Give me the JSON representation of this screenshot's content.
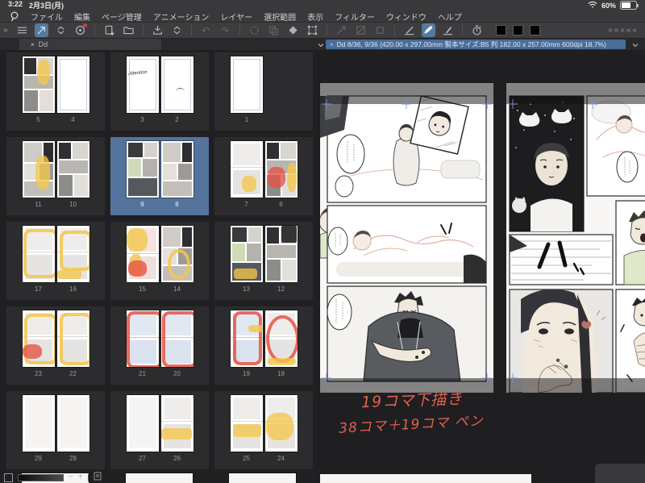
{
  "status_bar": {
    "time": "3:22",
    "date": "2月3日(月)",
    "battery_percent": "60%"
  },
  "menu_bar": {
    "items": [
      "ファイル",
      "編集",
      "ページ管理",
      "アニメーション",
      "レイヤー",
      "選択範囲",
      "表示",
      "フィルター",
      "ウィンドウ",
      "ヘルプ"
    ]
  },
  "toolbar": {
    "collapse_left": "»",
    "collapse_right": "«««««",
    "icons": [
      {
        "name": "main-menu"
      },
      {
        "name": "tool-cursor",
        "active": true
      },
      {
        "name": "chevron-updown"
      },
      {
        "name": "asset-library",
        "badge": true
      },
      {
        "name": "separator"
      },
      {
        "name": "new-page"
      },
      {
        "name": "open-folder"
      },
      {
        "name": "separator"
      },
      {
        "name": "export-tray"
      },
      {
        "name": "chevron-updown"
      },
      {
        "name": "separator"
      },
      {
        "name": "undo",
        "disabled": true
      },
      {
        "name": "redo",
        "disabled": true
      },
      {
        "name": "separator"
      },
      {
        "name": "spinner",
        "disabled": true
      },
      {
        "name": "paste",
        "disabled": true
      },
      {
        "name": "eraser"
      },
      {
        "name": "transform-frame"
      },
      {
        "name": "separator"
      },
      {
        "name": "select-line",
        "disabled": true
      },
      {
        "name": "select-fill",
        "disabled": true
      },
      {
        "name": "stamp",
        "disabled": true
      },
      {
        "name": "separator"
      },
      {
        "name": "ruler-pen"
      },
      {
        "name": "brush",
        "active": true
      },
      {
        "name": "pen-line"
      },
      {
        "name": "separator"
      },
      {
        "name": "auto-action-timer"
      }
    ],
    "swatches": [
      "#000000",
      "#000000",
      "#000000"
    ]
  },
  "tab_bar": {
    "panel_tab": {
      "close": "×",
      "label": "Dd"
    },
    "document_tab": {
      "close": "×",
      "title": "Dd 8/36, 9/36 (420.00 x 297.00mm 製本サイズ:B5 判 182.00 x 257.00mm 600dpi 18.7%)"
    }
  },
  "page_manager": {
    "spreads": [
      {
        "pages": [
          {
            "num": "5",
            "style": "art-a",
            "marks": [
              [
                "yellow",
                "blob",
                45,
                5,
                42,
                45
              ]
            ]
          },
          {
            "num": "4",
            "style": "blank"
          }
        ]
      },
      {
        "pages": [
          {
            "num": "3",
            "style": "blank",
            "note": "Attention"
          },
          {
            "num": "2",
            "style": "blank",
            "marks": [
              [
                "ink",
                "squiggle",
                45,
                55,
                28,
                12
              ]
            ]
          }
        ]
      },
      {
        "single": true,
        "pages": [
          {
            "num": "1",
            "style": "blank"
          }
        ]
      },
      {
        "pages": [
          {
            "num": "11",
            "style": "art-b",
            "marks": [
              [
                "yellow",
                "blob",
                40,
                25,
                45,
                60
              ]
            ]
          },
          {
            "num": "10",
            "style": "art-a"
          }
        ]
      },
      {
        "selected": true,
        "pages": [
          {
            "num": "9",
            "style": "art-c"
          },
          {
            "num": "8",
            "style": "art-b"
          }
        ]
      },
      {
        "pages": [
          {
            "num": "7",
            "style": "rough-a",
            "marks": [
              [
                "yellow",
                "blob",
                35,
                62,
                45,
                28
              ]
            ]
          },
          {
            "num": "6",
            "style": "art-a",
            "marks": [
              [
                "red",
                "blob",
                8,
                45,
                55,
                38
              ],
              [
                "yellow",
                "blob",
                68,
                38,
                30,
                52
              ]
            ]
          }
        ]
      },
      {
        "pages": [
          {
            "num": "17",
            "style": "rough-a",
            "marks": [
              [
                "yellow",
                "frame",
                4,
                6,
                88,
                76
              ]
            ]
          },
          {
            "num": "16",
            "style": "rough-a",
            "marks": [
              [
                "yellow",
                "frame",
                8,
                8,
                82,
                60
              ],
              [
                "yellow",
                "streak",
                0,
                78,
                75,
                16
              ]
            ]
          }
        ]
      },
      {
        "pages": [
          {
            "num": "15",
            "style": "rough-pink",
            "marks": [
              [
                "yellow",
                "blob",
                2,
                4,
                65,
                42
              ],
              [
                "yellow",
                "blob",
                12,
                50,
                38,
                38
              ],
              [
                "red",
                "blob",
                6,
                62,
                58,
                28
              ]
            ]
          },
          {
            "num": "14",
            "style": "art-b",
            "marks": [
              [
                "yellow",
                "ring",
                22,
                42,
                50,
                42
              ]
            ]
          }
        ]
      },
      {
        "pages": [
          {
            "num": "13",
            "style": "art-c",
            "marks": [
              [
                "yellow",
                "streak",
                12,
                76,
                72,
                18
              ]
            ]
          },
          {
            "num": "12",
            "style": "art-a",
            "marks": [
              [
                "dark",
                "blob",
                52,
                0,
                46,
                30
              ]
            ]
          }
        ]
      },
      {
        "pages": [
          {
            "num": "23",
            "style": "rough-a",
            "marks": [
              [
                "yellow",
                "frame",
                6,
                6,
                84,
                78
              ],
              [
                "red",
                "blob",
                0,
                60,
                62,
                26
              ]
            ]
          },
          {
            "num": "22",
            "style": "rough-a",
            "marks": [
              [
                "yellow",
                "frame",
                8,
                4,
                82,
                82
              ]
            ]
          }
        ]
      },
      {
        "pages": [
          {
            "num": "21",
            "style": "rough-blue",
            "marks": [
              [
                "red",
                "frame",
                2,
                2,
                92,
                90
              ]
            ]
          },
          {
            "num": "20",
            "style": "rough-blue",
            "marks": [
              [
                "red",
                "frame",
                4,
                2,
                90,
                88
              ]
            ]
          }
        ]
      },
      {
        "pages": [
          {
            "num": "19",
            "style": "rough-blue",
            "marks": [
              [
                "red",
                "frame",
                8,
                2,
                72,
                84
              ],
              [
                "yellow",
                "streak",
                55,
                26,
                45,
                12
              ]
            ]
          },
          {
            "num": "18",
            "style": "rough-a",
            "marks": [
              [
                "red",
                "ring",
                4,
                8,
                82,
                74
              ],
              [
                "yellow",
                "streak",
                8,
                84,
                88,
                13
              ]
            ]
          }
        ]
      },
      {
        "pages": [
          {
            "num": "29",
            "style": "faint"
          },
          {
            "num": "28",
            "style": "faint"
          }
        ]
      },
      {
        "pages": [
          {
            "num": "27",
            "style": "faint"
          },
          {
            "num": "26",
            "style": "rough-a",
            "marks": [
              [
                "yellow",
                "streak",
                0,
                58,
                96,
                20
              ]
            ]
          }
        ]
      },
      {
        "pages": [
          {
            "num": "25",
            "style": "rough-a",
            "marks": [
              [
                "yellow",
                "streak",
                8,
                52,
                88,
                22
              ]
            ]
          },
          {
            "num": "24",
            "style": "rough-a",
            "marks": [
              [
                "yellow",
                "blob",
                4,
                32,
                84,
                48
              ]
            ]
          }
        ]
      }
    ],
    "partial_next_row_count": 3,
    "zoom_controls": {
      "minus": "−",
      "plus": "+"
    }
  },
  "canvas": {
    "left_page_number": "9",
    "right_page_number": "8",
    "annotation_color": "#e2604e",
    "annotation_lines": [
      "19コマ下描き",
      "38コマ＋19コマ ペン"
    ]
  }
}
